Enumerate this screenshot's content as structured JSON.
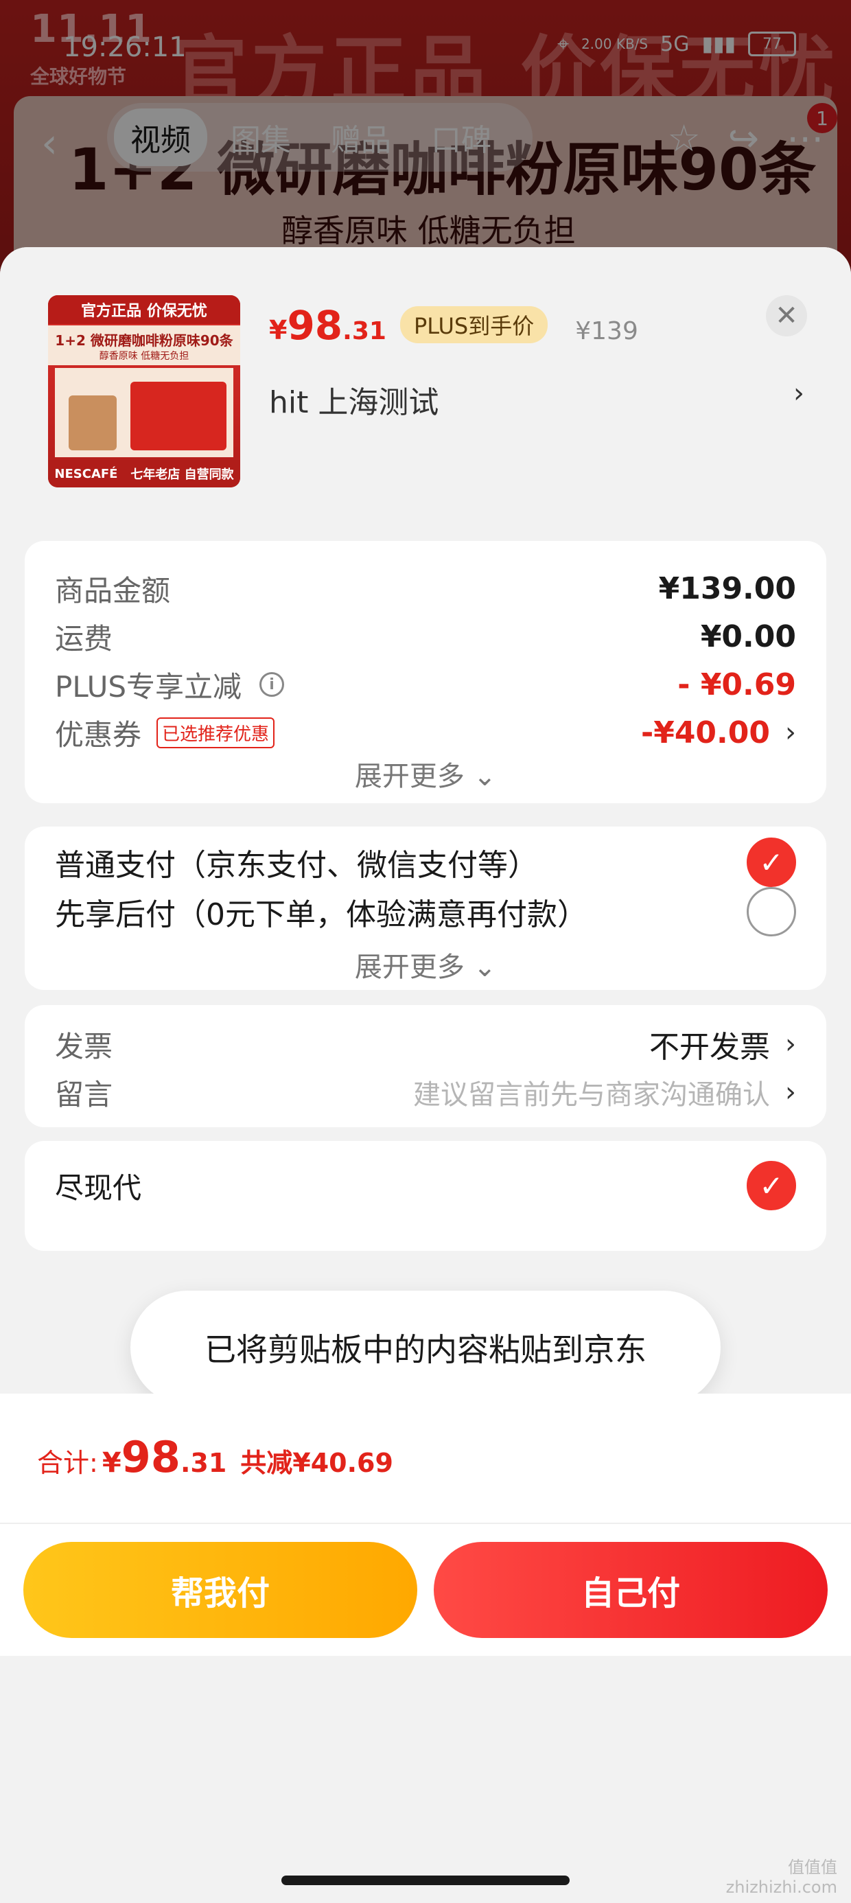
{
  "status_bar": {
    "time": "19:26:11",
    "net": "2.00 KB/S",
    "signal": "5G",
    "battery": "77"
  },
  "banner": {
    "logo": "11.11",
    "logo_sub": "全球好物节",
    "slogan": "官方正品 价保无忧"
  },
  "bg_product": {
    "title": "1+2 微研磨咖啡粉原味90条",
    "subtitle": "醇香原味 低糖无负担"
  },
  "nav": {
    "tabs": [
      "视频",
      "图集",
      "赠品",
      "口碑"
    ],
    "active_tab": 0,
    "badge": "1"
  },
  "product": {
    "thumb_top": "官方正品 价保无忧",
    "thumb_title": "1+2 微研磨咖啡粉原味90条",
    "thumb_sub": "醇香原味 低糖无负担",
    "thumb_bottom_left": "NESCAFÉ",
    "thumb_bottom_right": "七年老店 自营同款",
    "price_yen": "¥",
    "price_int": "98",
    "price_dec": ".31",
    "plus_badge": "PLUS到手价",
    "price_orig": "¥139",
    "address": "hit  上海测试"
  },
  "summary": {
    "rows": [
      {
        "label": "商品金额",
        "value": "¥139.00"
      },
      {
        "label": "运费",
        "value": "¥0.00"
      },
      {
        "label": "PLUS专享立减",
        "value": "- ¥0.69"
      },
      {
        "label": "优惠券",
        "tag": "已选推荐优惠",
        "value": "-¥40.00"
      }
    ],
    "expand": "展开更多 ⌄",
    "info_icon": "i"
  },
  "payment": {
    "options": [
      {
        "label": "普通支付（京东支付、微信支付等）",
        "checked": true
      },
      {
        "label": "先享后付（0元下单，体验满意再付款）",
        "checked": false
      }
    ],
    "expand": "展开更多 ⌄"
  },
  "other": {
    "invoice_label": "发票",
    "invoice_value": "不开发票",
    "message_label": "留言",
    "message_placeholder": "建议留言前先与商家沟通确认",
    "partial_label": "尽现代"
  },
  "toast": "已将剪贴板中的内容粘贴到京东",
  "footer": {
    "total_label": "合计:",
    "total_yen": "¥",
    "total_int": "98",
    "total_dec": ".31",
    "total_save": "共减¥40.69",
    "btn_help": "帮我付",
    "btn_self": "自己付"
  },
  "watermark": "值值值\nzhizhizhi.com",
  "colors": {
    "accent": "#e2231a",
    "plus_badge_bg": "#f9e2a8",
    "help_btn": "#ffb800",
    "self_btn": "#f0252a"
  }
}
